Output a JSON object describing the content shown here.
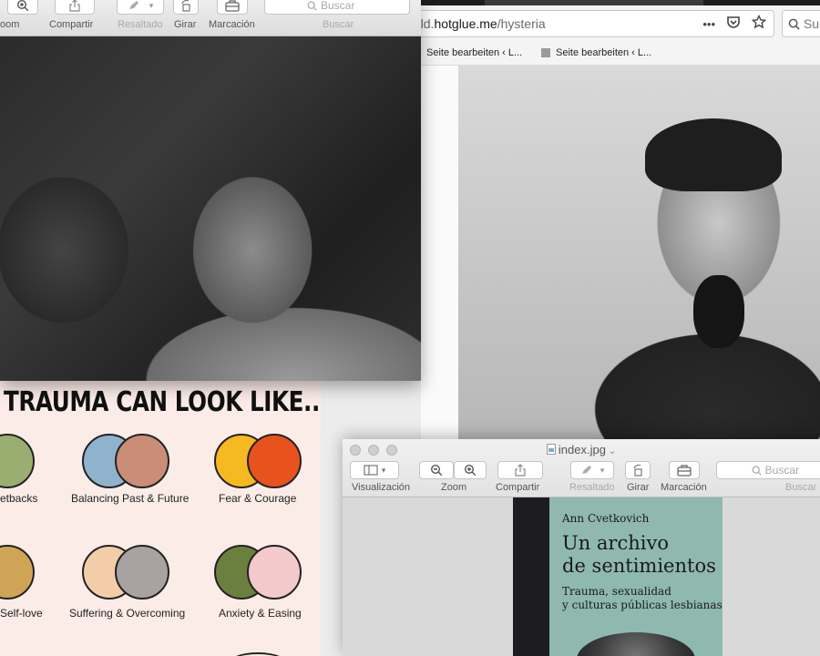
{
  "browser": {
    "url_prefix": "rld.",
    "url_domain": "hotglue.me",
    "url_path": "/hysteria",
    "menu_dots": "•••",
    "search_placeholder": "Su",
    "bookmarks": [
      {
        "label": "Seite bearbeiten ‹ L..."
      },
      {
        "label": "Seite bearbeiten ‹ L..."
      }
    ]
  },
  "preview_top": {
    "toolbar": {
      "zoom_label": "oom",
      "share_label": "Compartir",
      "highlight_label": "Resaltado",
      "rotate_label": "Girar",
      "markup_label": "Marcación",
      "search_placeholder": "Buscar",
      "search_label": "Buscar"
    }
  },
  "infographic": {
    "heading": "TRAUMA CAN LOOK LIKE...",
    "items": [
      {
        "label": "Setbacks",
        "c1": "#9aae72",
        "c2": "#9aae72"
      },
      {
        "label": "Balancing Past & Future",
        "c1": "#8fb3cd",
        "c2": "#c98d78"
      },
      {
        "label": "Fear & Courage",
        "c1": "#f6b921",
        "c2": "#e8521c"
      },
      {
        "label": "Self-love",
        "c1": "#d0a456",
        "c2": "#d0a456"
      },
      {
        "label": "Suffering & Overcoming",
        "c1": "#f2cda8",
        "c2": "#a8a2a2"
      },
      {
        "label": "Anxiety & Easing",
        "c1": "#6b7f3e",
        "c2": "#f3c9cb"
      }
    ]
  },
  "preview_bottom": {
    "title": "index.jpg",
    "toolbar": {
      "view_label": "Visualización",
      "zoom_label": "Zoom",
      "share_label": "Compartir",
      "highlight_label": "Resaltado",
      "rotate_label": "Girar",
      "markup_label": "Marcación",
      "search_placeholder": "Buscar",
      "search_label": "Buscar"
    },
    "book": {
      "author": "Ann Cvetkovich",
      "title_line1": "Un archivo",
      "title_line2": "de sentimientos",
      "subtitle_line1": "Trauma, sexualidad",
      "subtitle_line2": "y culturas públicas lesbianas",
      "cover_color": "#8fb9ae"
    }
  }
}
